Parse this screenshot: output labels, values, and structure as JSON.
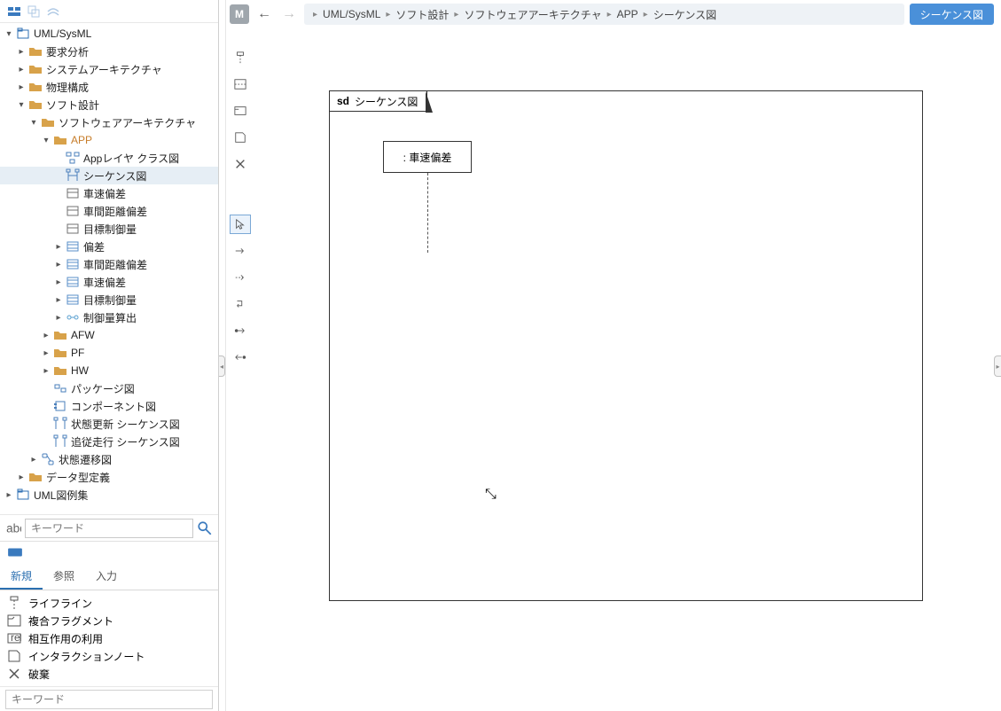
{
  "tree": {
    "root": "UML/SysML",
    "req": "要求分析",
    "sysarch": "システムアーキテクチャ",
    "phys": "物理構成",
    "soft": "ソフト設計",
    "swarch": "ソフトウェアアーキテクチャ",
    "app": "APP",
    "app_class": "Appレイヤ クラス図",
    "seq": "シーケンス図",
    "vdev": "車速偏差",
    "ddev": "車間距離偏差",
    "tctrl": "目標制御量",
    "blk_dev": "偏差",
    "blk_ddev": "車間距離偏差",
    "blk_vdev": "車速偏差",
    "blk_tctrl": "目標制御量",
    "flow_calc": "制御量算出",
    "afw": "AFW",
    "pf": "PF",
    "hw": "HW",
    "pkg_diag": "パッケージ図",
    "comp_diag": "コンポーネント図",
    "state_upd": "状態更新 シーケンス図",
    "follow": "追従走行 シーケンス図",
    "state_tr": "状態遷移図",
    "datatype": "データ型定義",
    "examples": "UML図例集"
  },
  "search": {
    "placeholder_tree": "キーワード"
  },
  "bp": {
    "tab_new": "新規",
    "tab_ref": "参照",
    "tab_in": "入力",
    "items": {
      "lifeline": "ライフライン",
      "combined": "複合フラグメント",
      "interaction": "相互作用の利用",
      "note": "インタラクションノート",
      "destroy": "破棄"
    },
    "placeholder": "キーワード"
  },
  "header": {
    "m": "M",
    "crumbs": {
      "c1": "UML/SysML",
      "c2": "ソフト設計",
      "c3": "ソフトウェアアーキテクチャ",
      "c4": "APP",
      "c5": "シーケンス図"
    },
    "tag": "シーケンス図"
  },
  "diagram": {
    "sd": "sd",
    "title": "シーケンス図",
    "lifeline": ": 車速偏差"
  }
}
